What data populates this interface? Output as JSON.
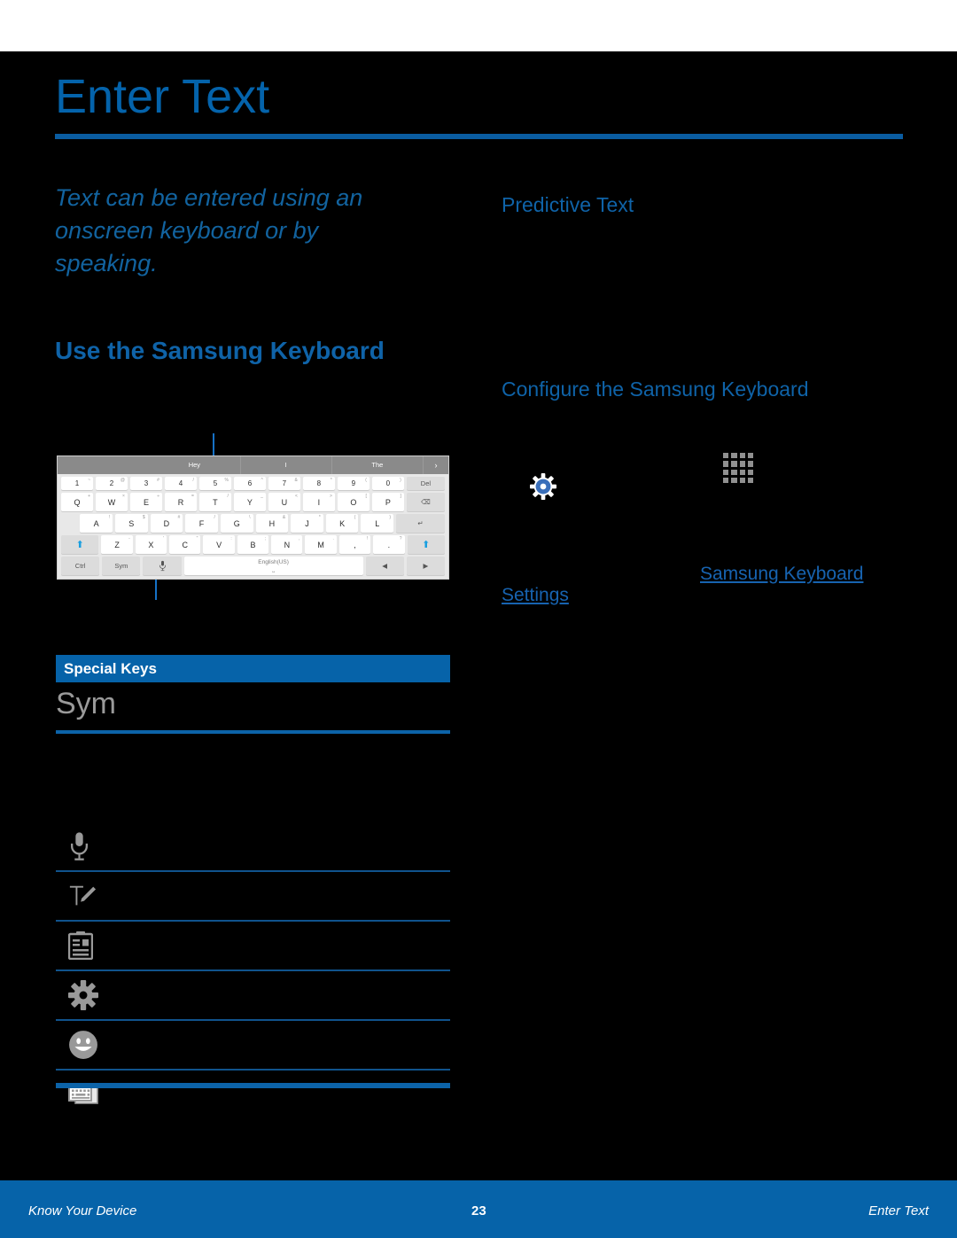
{
  "page": {
    "title": "Enter Text",
    "accent_blue": "#0663a9",
    "title_blue": "#0463ab",
    "background": "#000000"
  },
  "left_column": {
    "intro": "Text can be entered using an onscreen keyboard or by speaking.",
    "heading_use_keyboard": "Use the Samsung Keyboard",
    "keyboard_figure": {
      "suggestions": [
        "",
        "Hey",
        "I",
        "The"
      ],
      "suggestion_arrow": "›",
      "rows": {
        "numbers": [
          {
            "main": "1",
            "sup": "~"
          },
          {
            "main": "2",
            "sup": "@"
          },
          {
            "main": "3",
            "sup": "#"
          },
          {
            "main": "4",
            "sup": "/"
          },
          {
            "main": "5",
            "sup": "%"
          },
          {
            "main": "6",
            "sup": "^"
          },
          {
            "main": "7",
            "sup": "&"
          },
          {
            "main": "8",
            "sup": "*"
          },
          {
            "main": "9",
            "sup": "("
          },
          {
            "main": "0",
            "sup": ")"
          }
        ],
        "delete_label": "Del",
        "top": [
          {
            "main": "Q",
            "sup": "+"
          },
          {
            "main": "W",
            "sup": "×"
          },
          {
            "main": "E",
            "sup": "÷"
          },
          {
            "main": "R",
            "sup": "="
          },
          {
            "main": "T",
            "sup": "/"
          },
          {
            "main": "Y",
            "sup": "_"
          },
          {
            "main": "U",
            "sup": "<"
          },
          {
            "main": "I",
            "sup": ">"
          },
          {
            "main": "O",
            "sup": "["
          },
          {
            "main": "P",
            "sup": "]"
          }
        ],
        "backspace_glyph": "⌫",
        "home": [
          {
            "main": "A",
            "sup": "!"
          },
          {
            "main": "S",
            "sup": "$"
          },
          {
            "main": "D",
            "sup": "#"
          },
          {
            "main": "F",
            "sup": "/"
          },
          {
            "main": "G",
            "sup": "\\"
          },
          {
            "main": "H",
            "sup": "&"
          },
          {
            "main": "J",
            "sup": "*"
          },
          {
            "main": "K",
            "sup": "("
          },
          {
            "main": "L",
            "sup": ")"
          }
        ],
        "enter_glyph": "↵",
        "bottom": [
          {
            "main": "Z",
            "sup": "-"
          },
          {
            "main": "X",
            "sup": "'"
          },
          {
            "main": "C",
            "sup": "\""
          },
          {
            "main": "V",
            "sup": ":"
          },
          {
            "main": "B",
            "sup": ";"
          },
          {
            "main": "N",
            "sup": ","
          },
          {
            "main": "M",
            "sup": "."
          },
          {
            "main": ",",
            "sup": "!"
          },
          {
            "main": ".",
            "sup": "?"
          }
        ],
        "shift_glyph": "⬆",
        "control": [
          {
            "main": "Ctrl"
          },
          {
            "main": "Sym"
          }
        ],
        "mic_glyph": "Ἲ4",
        "space_label": "English(US)",
        "arrow_left": "◀",
        "arrow_right": "▶"
      }
    },
    "special_keys": {
      "header": "Special Keys",
      "sym_label": "Sym",
      "rows": [
        {
          "icon": "microphone-icon",
          "label": ""
        },
        {
          "icon": "handwriting-icon",
          "label": ""
        },
        {
          "icon": "clipboard-icon",
          "label": ""
        },
        {
          "icon": "gear-icon",
          "label": ""
        },
        {
          "icon": "emoticon-icon",
          "label": ""
        },
        {
          "icon": "keyboard-layout-icon",
          "label": ""
        }
      ]
    }
  },
  "right_column": {
    "heading_predictive_text": "Predictive Text",
    "heading_configure_keyboard": "Configure the Samsung Keyboard",
    "icons": {
      "settings_gear": "gear-icon",
      "apps_grid": "apps-grid-icon"
    },
    "links": {
      "samsung_keyboard": "Samsung Keyboard",
      "settings": "Settings"
    }
  },
  "footer": {
    "left": "Know Your Device",
    "page_number": "23",
    "right": "Enter Text"
  }
}
